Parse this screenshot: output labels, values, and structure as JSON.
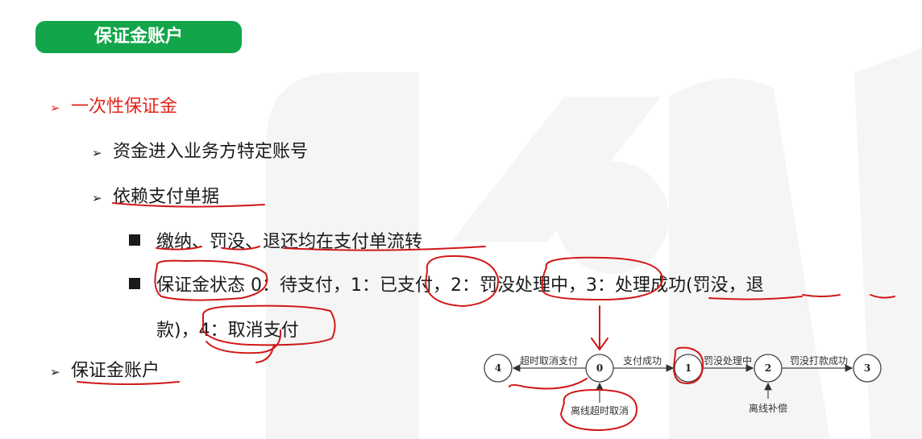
{
  "header": {
    "title": "保证金账户"
  },
  "bullets": {
    "b1": "一次性保证金",
    "b1_1": "资金进入业务方特定账号",
    "b1_2": "依赖支付单据",
    "b1_2_1": "缴纳、罚没、退还均在支付单流转",
    "b1_2_2_line1": "保证金状态 0：待支付，1：已支付，2：罚没处理中，3：处理成功(罚没，退",
    "b1_2_2_line2": "款)，4：取消支付",
    "b2": "保证金账户"
  },
  "diagram": {
    "states": [
      "4",
      "0",
      "1",
      "2",
      "3"
    ],
    "edges": {
      "e_0_4": "超时取消支付",
      "e_0_1": "支付成功",
      "e_1_2": "罚没处理中",
      "e_2_3": "罚没打款成功"
    },
    "events": {
      "offline_cancel": "离线超时取消",
      "offline_compensate": "离线补偿"
    }
  },
  "colors": {
    "header_bg": "#13a54a",
    "accent_red": "#e1251b",
    "annotation": "#d01818"
  },
  "icons": {
    "bullet_arrow": "➢",
    "bullet_square": "square-bullet"
  }
}
